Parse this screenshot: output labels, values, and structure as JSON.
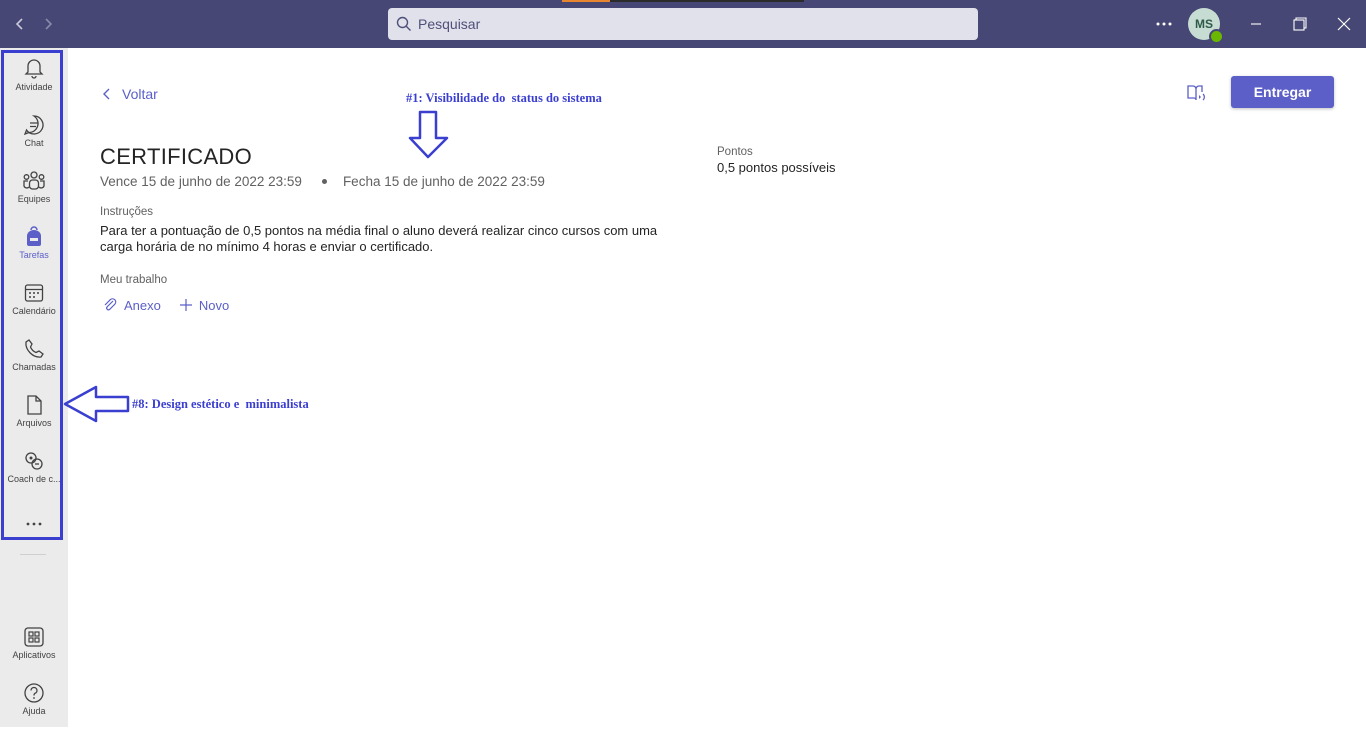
{
  "titlebar": {
    "search_placeholder": "Pesquisar",
    "avatar_initials": "MS",
    "more_icon": "more-horizontal-icon",
    "bg_color": "#464775"
  },
  "rail": {
    "items": [
      {
        "label": "Atividade",
        "icon": "bell-icon"
      },
      {
        "label": "Chat",
        "icon": "chat-icon"
      },
      {
        "label": "Equipes",
        "icon": "teams-icon"
      },
      {
        "label": "Tarefas",
        "icon": "backpack-icon",
        "active": true
      },
      {
        "label": "Calendário",
        "icon": "calendar-icon"
      },
      {
        "label": "Chamadas",
        "icon": "phone-icon"
      },
      {
        "label": "Arquivos",
        "icon": "file-icon"
      },
      {
        "label": "Coach de c...",
        "icon": "coach-icon"
      }
    ],
    "bottom_items": [
      {
        "label": "Aplicativos",
        "icon": "apps-icon"
      },
      {
        "label": "Ajuda",
        "icon": "help-icon"
      }
    ]
  },
  "main": {
    "back_label": "Voltar",
    "submit_label": "Entregar",
    "title": "CERTIFICADO",
    "due": "Vence 15 de junho de 2022 23:59",
    "closes": "Fecha 15 de junho de 2022 23:59",
    "instructions_label": "Instruções",
    "instructions_text": "Para ter a pontuação de 0,5 pontos na média final o aluno deverá realizar cinco cursos com uma carga horária de no mínimo 4 horas e enviar o certificado.",
    "my_work_label": "Meu trabalho",
    "attach_label": "Anexo",
    "new_label": "Novo",
    "points_label": "Pontos",
    "points_value": "0,5 pontos possíveis",
    "accent_color": "#5b5fc7"
  },
  "annotations": {
    "one": "#1: Visibilidade do  status do sistema",
    "eight": "#8: Design estético e  minimalista",
    "color": "#3b3fd0"
  }
}
